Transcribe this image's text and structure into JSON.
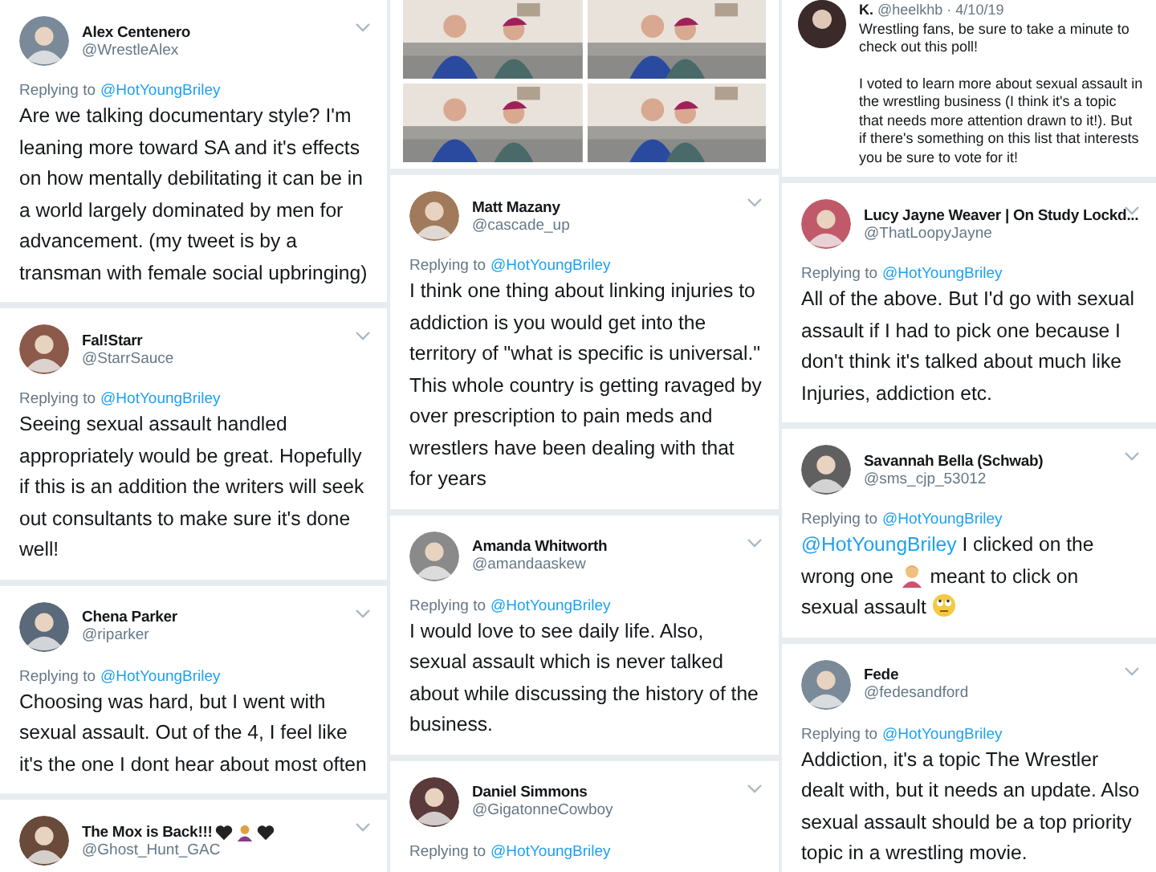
{
  "columns": [
    {
      "items": [
        {
          "kind": "tweet",
          "name": "Alex Centenero",
          "handle": "@WrestleAlex",
          "reply_label": "Replying to",
          "replying_to": "@HotYoungBriley",
          "body": "Are we talking documentary style? I'm leaning more toward SA and it's effects on how mentally debilitating it can be in a world largely dominated by men for advancement. (my tweet is by a transman with female social upbringing)"
        },
        {
          "kind": "tweet",
          "name": "Fal!Starr",
          "handle": "@StarrSauce",
          "reply_label": "Replying to",
          "replying_to": "@HotYoungBriley",
          "body": "Seeing sexual assault handled appropriately would be great. Hopefully if this is an addition the writers will seek out consultants to make sure it's done well!"
        },
        {
          "kind": "tweet",
          "name": "Chena Parker",
          "handle": "@riparker",
          "reply_label": "Replying to",
          "replying_to": "@HotYoungBriley",
          "body": "Choosing was hard, but I went with sexual assault. Out of the 4, I feel like it's the one I dont hear about most often"
        },
        {
          "kind": "tweet",
          "name": "The Mox is Back!!!",
          "name_icons": [
            {
              "kind": "heart"
            },
            {
              "kind": "person"
            },
            {
              "kind": "heart"
            }
          ],
          "handle": "@Ghost_Hunt_GAC"
        }
      ]
    },
    {
      "items": [
        {
          "kind": "photos"
        },
        {
          "kind": "tweet",
          "name": "Matt Mazany",
          "handle": "@cascade_up",
          "reply_label": "Replying to",
          "replying_to": "@HotYoungBriley",
          "body": "I think one thing about linking injuries to addiction is you would get into the territory of \"what is specific is universal.\" This whole country is getting ravaged by over prescription to pain meds and wrestlers have been dealing with that for years"
        },
        {
          "kind": "tweet",
          "name": "Amanda Whitworth",
          "handle": "@amandaaskew",
          "reply_label": "Replying to",
          "replying_to": "@HotYoungBriley",
          "body": "I would love to see daily life. Also, sexual assault which is never talked about while discussing the history of the business."
        },
        {
          "kind": "tweet",
          "name": "Daniel Simmons",
          "handle": "@GigatonneCowboy",
          "reply_label": "Replying to",
          "replying_to": "@HotYoungBriley"
        }
      ]
    },
    {
      "items": [
        {
          "kind": "quote",
          "name": "K.",
          "handle": "@heelkhb · 4/10/19",
          "paragraphs": [
            "Wrestling fans, be sure to take a minute to check out this poll!",
            "I voted to learn more about sexual assault in the wrestling business (I think it's a topic that needs more attention drawn to it!). But if there's something on this list that interests you be sure to vote for it!"
          ]
        },
        {
          "kind": "tweet",
          "name": "Lucy Jayne Weaver | On Study Lockd...",
          "handle": "@ThatLoopyJayne",
          "reply_label": "Replying to",
          "replying_to": "@HotYoungBriley",
          "body": "All of the above. But I'd go with sexual assault if I had to pick one because I don't think it's talked about much like Injuries, addiction etc."
        },
        {
          "kind": "tweet",
          "name": "Savannah Bella (Schwab)",
          "handle": "@sms_cjp_53012",
          "reply_label": "Replying to",
          "replying_to": "@HotYoungBriley",
          "body_parts": [
            {
              "kind": "mention",
              "text": "@HotYoungBriley"
            },
            {
              "kind": "text",
              "text": " I clicked on the wrong one "
            },
            {
              "kind": "facepalm"
            },
            {
              "kind": "text",
              "text": " meant to click on sexual assault "
            },
            {
              "kind": "eyeroll"
            }
          ]
        },
        {
          "kind": "tweet",
          "name": "Fede",
          "handle": "@fedesandford",
          "reply_label": "Replying to",
          "replying_to": "@HotYoungBriley",
          "body": "Addiction, it's a topic The Wrestler dealt with, but it needs an update. Also sexual assault should be a top priority topic in a wrestling movie."
        }
      ]
    }
  ]
}
